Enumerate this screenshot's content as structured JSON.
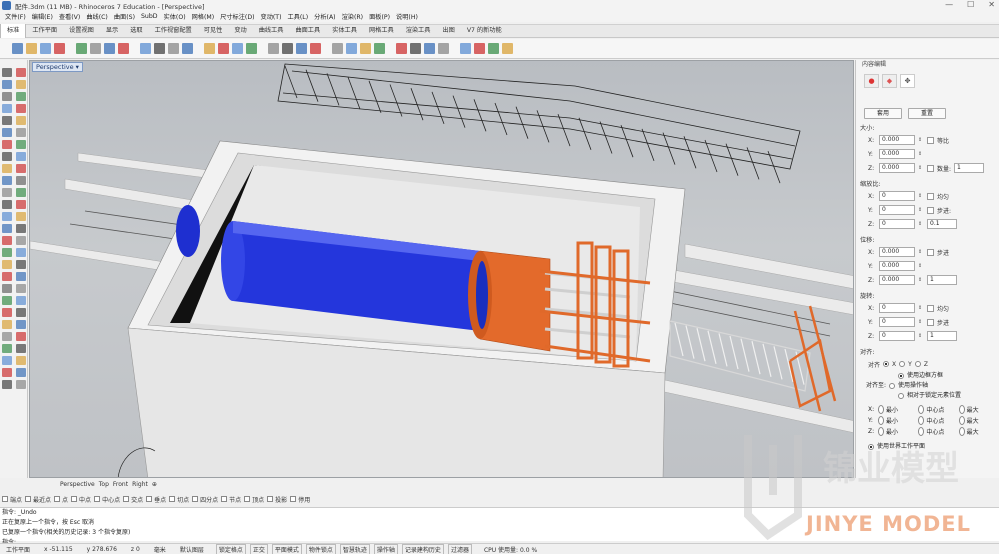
{
  "titlebar": {
    "title": "配件.3dm (11 MB) - Rhinoceros 7 Education - [Perspective]",
    "min": "—",
    "max": "☐",
    "close": "✕"
  },
  "menu": [
    "文件(F)",
    "编辑(E)",
    "查看(V)",
    "曲线(C)",
    "曲面(S)",
    "SubD",
    "实体(O)",
    "网格(M)",
    "尺寸标注(D)",
    "变动(T)",
    "工具(L)",
    "分析(A)",
    "渲染(R)",
    "面板(P)",
    "说明(H)"
  ],
  "tabs": [
    "标准",
    "工作平面",
    "设置视图",
    "显示",
    "选取",
    "工作视窗配置",
    "可见性",
    "变动",
    "曲线工具",
    "曲面工具",
    "实体工具",
    "网格工具",
    "渲染工具",
    "出图",
    "V7 的新功能"
  ],
  "active_tab_index": 0,
  "viewport": {
    "label": "Perspective",
    "arrow": "▾"
  },
  "right_panel": {
    "header": "内容编辑",
    "tab_icons": [
      "●",
      "◆",
      "✥"
    ],
    "buttons": {
      "apply": "套用",
      "reset": "重置"
    },
    "size": {
      "title": "大小:",
      "rows": [
        {
          "axis": "X:",
          "value": "0.000",
          "extra": "等比",
          "spin": ""
        },
        {
          "axis": "Y:",
          "value": "0.000",
          "extra": "",
          "spin": ""
        },
        {
          "axis": "Z:",
          "value": "0.000",
          "extra": "数量:",
          "spin": "1"
        }
      ]
    },
    "scale": {
      "title": "缩放比:",
      "rows": [
        {
          "axis": "X:",
          "value": "0",
          "extra": "均匀",
          "spin": ""
        },
        {
          "axis": "Y:",
          "value": "0",
          "extra": "步进:",
          "spin": ""
        },
        {
          "axis": "Z:",
          "value": "0",
          "extra": "",
          "spin": "0.1"
        }
      ]
    },
    "move": {
      "title": "位移:",
      "rows": [
        {
          "axis": "X:",
          "value": "0.000",
          "extra": "步进",
          "spin": ""
        },
        {
          "axis": "Y:",
          "value": "0.000",
          "extra": "",
          "spin": ""
        },
        {
          "axis": "Z:",
          "value": "0.000",
          "extra": "",
          "spin": "1"
        }
      ]
    },
    "rotate": {
      "title": "旋转:",
      "rows": [
        {
          "axis": "X:",
          "value": "0",
          "extra": "均匀",
          "spin": ""
        },
        {
          "axis": "Y:",
          "value": "0",
          "extra": "步进",
          "spin": ""
        },
        {
          "axis": "Z:",
          "value": "0",
          "extra": "",
          "spin": "1"
        }
      ]
    },
    "align": {
      "title": "对齐:",
      "axis_label": "对齐",
      "axes": [
        "X",
        "Y",
        "Z"
      ],
      "selected_axis": "X",
      "align_to_label": "对齐至:",
      "options": [
        "使用边框方框",
        "使用操作轴",
        "相对于锁定元素位置"
      ],
      "selected_option": 0,
      "grid": [
        {
          "axis": "X:",
          "items": [
            "最小",
            "中心点",
            "最大"
          ]
        },
        {
          "axis": "Y:",
          "items": [
            "最小",
            "中心点",
            "最大"
          ]
        },
        {
          "axis": "Z:",
          "items": [
            "最小",
            "中心点",
            "最大"
          ]
        }
      ],
      "footer": "使用世界工作平面"
    }
  },
  "viewport_tabs": [
    "Perspective",
    "Top",
    "Front",
    "Right",
    "⊕"
  ],
  "osnap": [
    "端点",
    "最近点",
    "点",
    "中点",
    "中心点",
    "交点",
    "垂点",
    "切点",
    "四分点",
    "节点",
    "顶点",
    "投影",
    "停用"
  ],
  "command_history": [
    "指令: _Undo",
    "正在复原上一个指令，按 Esc 取消",
    "已复原一个指令(相关的历史记录: 3 个指令复原)",
    "指令:"
  ],
  "statusbar": {
    "plane": "工作平面",
    "x": "x -51.115",
    "y": "y 278.676",
    "z": "z 0",
    "unit": "毫米",
    "layer": "默认图层",
    "toggles": [
      "锁定格点",
      "正交",
      "平面模式",
      "物件锁点",
      "智慧轨迹",
      "操作轴",
      "记录建构历史",
      "过滤器"
    ],
    "cpu": "CPU 使用量: 0.0 %"
  },
  "watermark": {
    "text": "JINYE MODEL",
    "cn": "锦业模型"
  },
  "colors": {
    "accent_blue": "#3a6fb5",
    "model_orange": "#e0692a",
    "model_blue": "#2233d8",
    "box_grey": "#e9e9e9"
  }
}
